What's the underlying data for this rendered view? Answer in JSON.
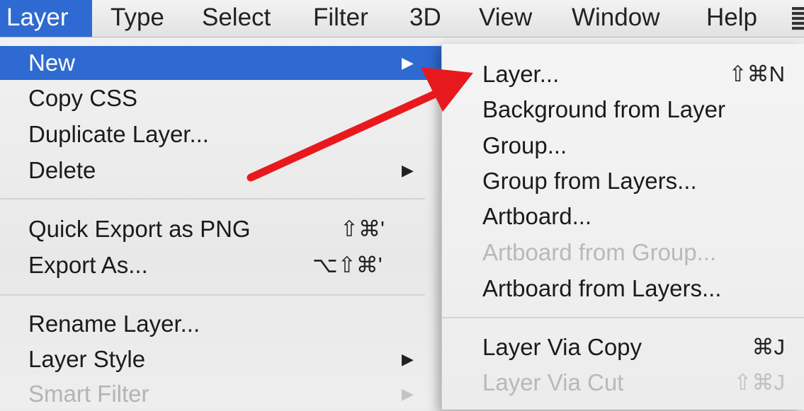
{
  "menubar": {
    "items": [
      "Layer",
      "Type",
      "Select",
      "Filter",
      "3D",
      "View",
      "Window",
      "Help"
    ],
    "active": "Layer"
  },
  "menu": {
    "items": [
      {
        "label": "New",
        "shortcut": "",
        "submenu": true,
        "state": "selected"
      },
      {
        "label": "Copy CSS",
        "shortcut": "",
        "submenu": false,
        "state": "enabled"
      },
      {
        "label": "Duplicate Layer...",
        "shortcut": "",
        "submenu": false,
        "state": "enabled"
      },
      {
        "label": "Delete",
        "shortcut": "",
        "submenu": true,
        "state": "enabled"
      },
      {
        "label": "Quick Export as PNG",
        "shortcut": "⇧⌘'",
        "submenu": false,
        "state": "enabled"
      },
      {
        "label": "Export As...",
        "shortcut": "⌥⇧⌘'",
        "submenu": false,
        "state": "enabled"
      },
      {
        "label": "Rename Layer...",
        "shortcut": "",
        "submenu": false,
        "state": "enabled"
      },
      {
        "label": "Layer Style",
        "shortcut": "",
        "submenu": true,
        "state": "enabled"
      },
      {
        "label": "Smart Filter",
        "shortcut": "",
        "submenu": true,
        "state": "disabled"
      }
    ],
    "submenu_arrow": "▶"
  },
  "submenu": {
    "parent": "New",
    "items": [
      {
        "label": "Layer...",
        "shortcut": "⇧⌘N",
        "state": "enabled"
      },
      {
        "label": "Background from Layer",
        "shortcut": "",
        "state": "enabled"
      },
      {
        "label": "Group...",
        "shortcut": "",
        "state": "enabled"
      },
      {
        "label": "Group from Layers...",
        "shortcut": "",
        "state": "enabled"
      },
      {
        "label": "Artboard...",
        "shortcut": "",
        "state": "enabled"
      },
      {
        "label": "Artboard from Group...",
        "shortcut": "",
        "state": "disabled"
      },
      {
        "label": "Artboard from Layers...",
        "shortcut": "",
        "state": "enabled"
      },
      {
        "label": "Layer Via Copy",
        "shortcut": "⌘J",
        "state": "enabled"
      },
      {
        "label": "Layer Via Cut",
        "shortcut": "⇧⌘J",
        "state": "disabled"
      }
    ]
  },
  "colors": {
    "highlight": "#2e6ad1",
    "annotation_arrow": "#e8191d",
    "disabled_text": "#b4b4b4"
  },
  "icons": {
    "submenu_indicator": "triangle-right-icon",
    "annotation": "red-arrow-icon"
  }
}
